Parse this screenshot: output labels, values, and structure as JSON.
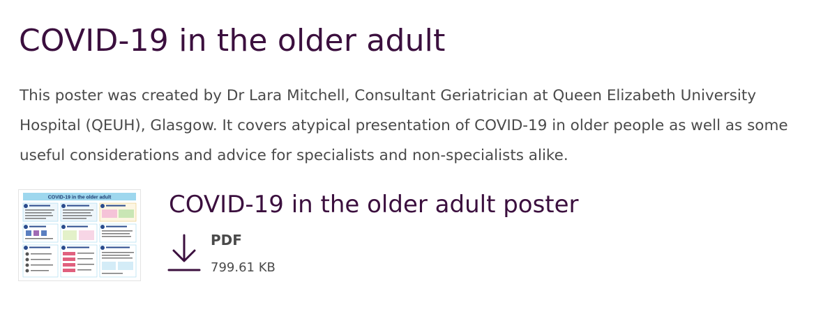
{
  "page": {
    "title": "COVID-19 in the older adult",
    "intro": "This poster was created by Dr Lara Mitchell, Consultant Geriatrician at Queen Elizabeth University Hospital (QEUH), Glasgow. It covers atypical presentation of COVID-19 in older people as well as some useful considerations and advice for specialists and non-specialists alike."
  },
  "resource": {
    "title": "COVID-19 in the older adult poster",
    "file_type": "PDF",
    "file_size": "799.61 KB",
    "icon": "download-icon",
    "thumbnail": {
      "icon": "poster-thumbnail",
      "heading": "COVID-19 in the older adult"
    }
  },
  "colors": {
    "title": "#3b0f3e",
    "body_text": "#4a4a4a",
    "icon": "#3b0f3e"
  }
}
